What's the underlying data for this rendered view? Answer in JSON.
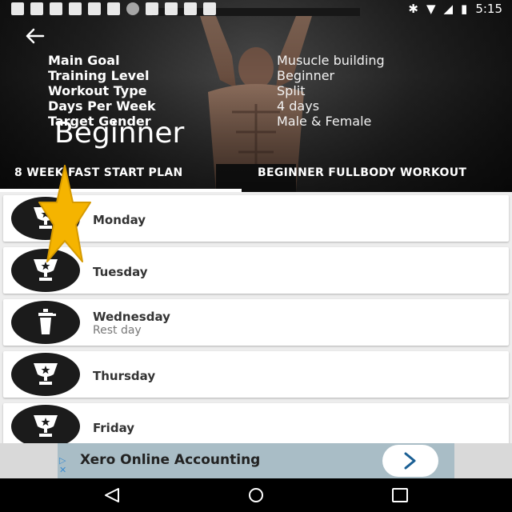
{
  "status_bar": {
    "time": "5:15"
  },
  "header": {
    "back_icon": "arrow-left-icon",
    "info": [
      {
        "label": "Main Goal",
        "value": "Musucle building"
      },
      {
        "label": "Training Level",
        "value": "Beginner"
      },
      {
        "label": "Workout Type",
        "value": "Split"
      },
      {
        "label": "Days Per Week",
        "value": "4 days"
      },
      {
        "label": "Target Gender",
        "value": "Male & Female"
      }
    ],
    "level_title": "Beginner"
  },
  "tabs": [
    {
      "label": "8 WEEK FAST START PLAN",
      "active": true
    },
    {
      "label": "BEGINNER FULLBODY WORKOUT",
      "active": false
    }
  ],
  "days": [
    {
      "day": "Monday",
      "subtitle": "",
      "icon": "trophy-icon"
    },
    {
      "day": "Tuesday",
      "subtitle": "",
      "icon": "trophy-icon"
    },
    {
      "day": "Wednesday",
      "subtitle": "Rest day",
      "icon": "shaker-bottle-icon"
    },
    {
      "day": "Thursday",
      "subtitle": "",
      "icon": "trophy-icon"
    },
    {
      "day": "Friday",
      "subtitle": "",
      "icon": "trophy-icon"
    }
  ],
  "ad": {
    "text": "Xero Online Accounting",
    "button_icon": "chevron-right-icon"
  },
  "colors": {
    "star": "#f5b400",
    "disc": "#1b1b1b",
    "ad_bg": "#a9bdc6"
  }
}
